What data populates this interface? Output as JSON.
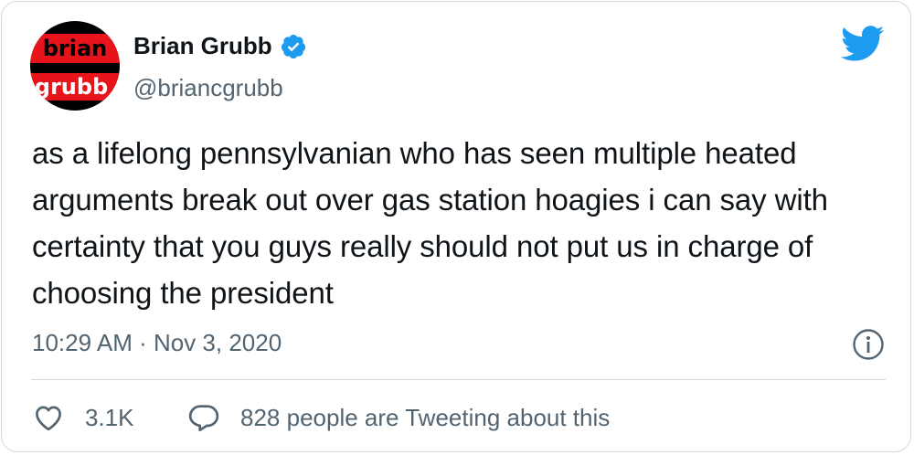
{
  "author": {
    "name": "Brian Grubb",
    "handle": "@briancgrubb",
    "avatar_text_top": "brian",
    "avatar_text_bottom": "grubb",
    "verified": true
  },
  "tweet": {
    "text": "as a lifelong pennsylvanian who has seen multiple heated arguments break out over gas station hoagies i can say with certainty that you guys really should not put us in charge of choosing the president",
    "timestamp": "10:29 AM · Nov 3, 2020"
  },
  "actions": {
    "likes": "3.1K",
    "tweeting": "828 people are Tweeting about this"
  },
  "icons": {
    "logo": "twitter-bird-icon",
    "verified": "verified-badge-icon",
    "info": "info-icon",
    "like": "heart-icon",
    "reply": "speech-bubble-icon"
  },
  "colors": {
    "brand": "#1d9bf0",
    "text": "#0f1419",
    "muted": "#536471",
    "border": "#cfd9de",
    "avatar_red": "#e8141c",
    "avatar_black": "#000000"
  }
}
